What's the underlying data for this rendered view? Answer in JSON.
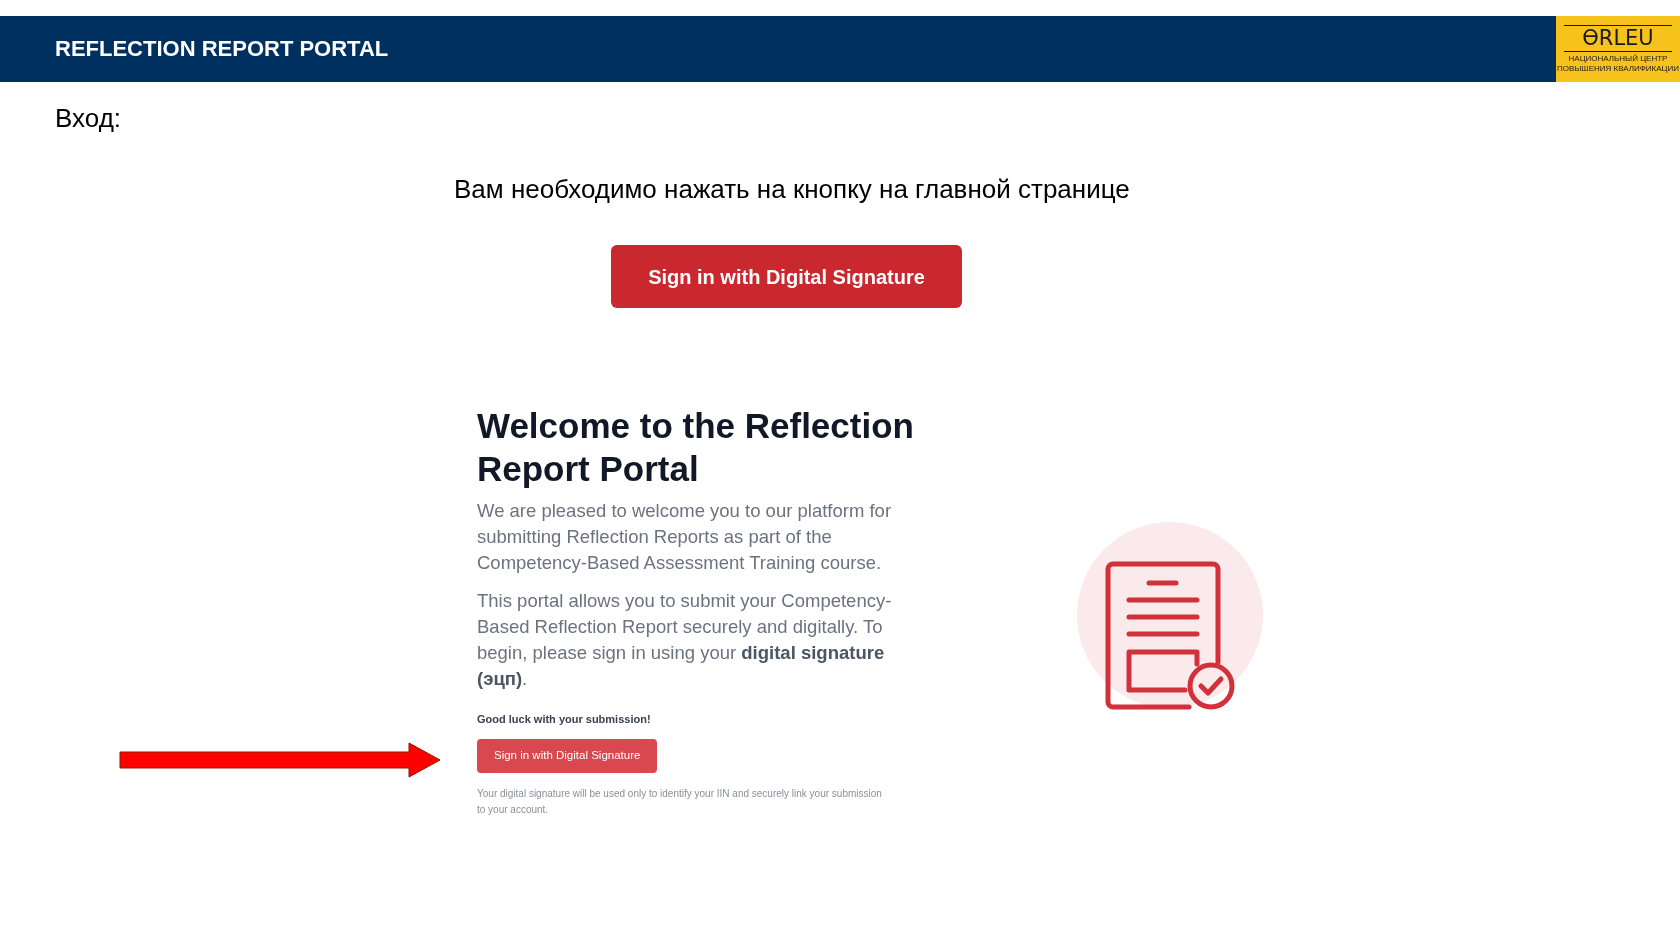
{
  "header": {
    "title": "REFLECTION REPORT PORTAL",
    "logo": {
      "wordmark": "ӨRLEU",
      "caption_lines": [
        "НАЦИОНАЛЬНЫЙ ЦЕНТР",
        "ПОВЫШЕНИЯ КВАЛИФИКАЦИИ"
      ]
    }
  },
  "section_label": "Вход:",
  "instruction": "Вам необходимо нажать на кнопку на главной странице",
  "highlighted_button": {
    "label": "Sign in with Digital Signature"
  },
  "portal_screenshot": {
    "heading": "Welcome to the Reflection Report Portal",
    "paragraphs": [
      "We are pleased to welcome you to our platform for submitting Reflection Reports as part of the Competency-Based Assessment Training course.",
      "This portal allows you to submit your Competency-Based Reflection Report securely and digitally. To begin, please sign in using your **digital signature (эцп)**."
    ],
    "closing": "Good luck with your submission!",
    "button": {
      "label": "Sign in with Digital Signature"
    },
    "note": "Your digital signature will be used only to identify your IIN and securely link your submission to your account."
  }
}
